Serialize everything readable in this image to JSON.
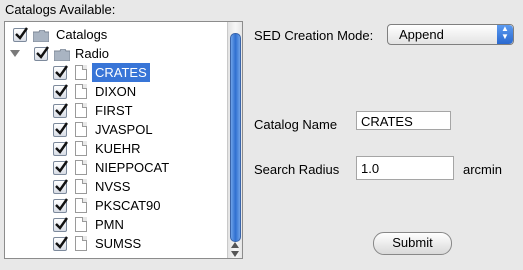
{
  "catalogs_label": "Catalogs Available:",
  "tree": {
    "root": "Catalogs",
    "group": "Radio",
    "items": [
      {
        "label": "CRATES",
        "selected": true
      },
      {
        "label": "DIXON"
      },
      {
        "label": "FIRST"
      },
      {
        "label": "JVASPOL"
      },
      {
        "label": "KUEHR"
      },
      {
        "label": "NIEPPOCAT"
      },
      {
        "label": "NVSS"
      },
      {
        "label": "PKSCAT90"
      },
      {
        "label": "PMN"
      },
      {
        "label": "SUMSS"
      }
    ]
  },
  "sed": {
    "label": "SED Creation Mode:",
    "value": "Append"
  },
  "catalog_name": {
    "label": "Catalog Name",
    "value": "CRATES"
  },
  "search_radius": {
    "label": "Search Radius",
    "value": "1.0",
    "unit": "arcmin"
  },
  "submit_label": "Submit",
  "colors": {
    "selection": "#3875d7",
    "accent": "#2f6fd0"
  }
}
